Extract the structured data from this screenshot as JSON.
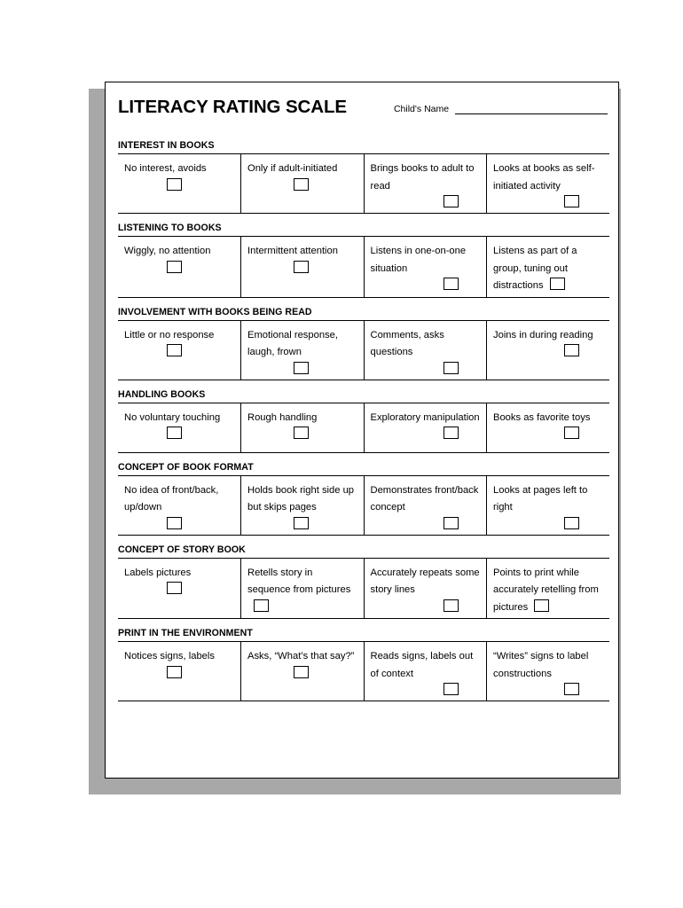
{
  "document": {
    "title": "LITERACY RATING SCALE",
    "name_field": {
      "label": "Child's Name",
      "value": ""
    }
  },
  "sections": [
    {
      "title": "INTEREST IN BOOKS",
      "items": [
        {
          "text": "No interest, avoids",
          "checkbox": "unchecked",
          "box_layout": "own-line",
          "box_pos": "pos-a"
        },
        {
          "text": "Only if adult-initiated",
          "checkbox": "unchecked",
          "box_layout": "own-line",
          "box_pos": "pos-b"
        },
        {
          "text": "Brings books to adult to read",
          "checkbox": "unchecked",
          "box_layout": "own-line",
          "box_pos": "pos-c"
        },
        {
          "text": "Looks at books as self-initiated activity",
          "checkbox": "unchecked",
          "box_layout": "own-line",
          "box_pos": "pos-d"
        }
      ]
    },
    {
      "title": "LISTENING TO BOOKS",
      "items": [
        {
          "text": "Wiggly, no attention",
          "checkbox": "unchecked",
          "box_layout": "own-line",
          "box_pos": "pos-a"
        },
        {
          "text": "Intermittent attention",
          "checkbox": "unchecked",
          "box_layout": "own-line",
          "box_pos": "pos-b"
        },
        {
          "text": "Listens in one-on-one situation",
          "checkbox": "unchecked",
          "box_layout": "own-line",
          "box_pos": "pos-c"
        },
        {
          "text": "Listens as part of a group, tuning out distractions",
          "checkbox": "unchecked",
          "box_layout": "inline"
        }
      ]
    },
    {
      "title": "INVOLVEMENT WITH BOOKS BEING READ",
      "items": [
        {
          "text": "Little or no response",
          "checkbox": "unchecked",
          "box_layout": "own-line",
          "box_pos": "pos-a"
        },
        {
          "text": "Emotional response, laugh, frown",
          "checkbox": "unchecked",
          "box_layout": "own-line",
          "box_pos": "pos-b"
        },
        {
          "text": "Comments, asks questions",
          "checkbox": "unchecked",
          "box_layout": "own-line",
          "box_pos": "pos-c"
        },
        {
          "text": "Joins in during reading",
          "checkbox": "unchecked",
          "box_layout": "own-line",
          "box_pos": "pos-d"
        }
      ]
    },
    {
      "title": "HANDLING BOOKS",
      "items": [
        {
          "text": "No voluntary touching",
          "checkbox": "unchecked",
          "box_layout": "own-line",
          "box_pos": "pos-a"
        },
        {
          "text": "Rough handling",
          "checkbox": "unchecked",
          "box_layout": "own-line",
          "box_pos": "pos-b"
        },
        {
          "text": "Exploratory manipulation",
          "checkbox": "unchecked",
          "box_layout": "own-line",
          "box_pos": "pos-c"
        },
        {
          "text": "Books as favorite toys",
          "checkbox": "unchecked",
          "box_layout": "own-line",
          "box_pos": "pos-d"
        }
      ]
    },
    {
      "title": "CONCEPT OF BOOK FORMAT",
      "items": [
        {
          "text": "No idea of front/back, up/down",
          "checkbox": "unchecked",
          "box_layout": "own-line",
          "box_pos": "pos-a"
        },
        {
          "text": "Holds book right side up but skips pages",
          "checkbox": "unchecked",
          "box_layout": "own-line",
          "box_pos": "pos-b"
        },
        {
          "text": "Demonstrates front/back concept",
          "checkbox": "unchecked",
          "box_layout": "own-line",
          "box_pos": "pos-c"
        },
        {
          "text": "Looks at pages left to right",
          "checkbox": "unchecked",
          "box_layout": "own-line",
          "box_pos": "pos-d"
        }
      ]
    },
    {
      "title": "CONCEPT OF STORY BOOK",
      "items": [
        {
          "text": "Labels pictures",
          "checkbox": "unchecked",
          "box_layout": "own-line",
          "box_pos": "pos-a"
        },
        {
          "text": "Retells story in sequence from pictures",
          "checkbox": "unchecked",
          "box_layout": "inline"
        },
        {
          "text": "Accurately repeats some story lines",
          "checkbox": "unchecked",
          "box_layout": "own-line",
          "box_pos": "pos-c"
        },
        {
          "text": "Points to print while accurately retelling from pictures",
          "checkbox": "unchecked",
          "box_layout": "inline"
        }
      ]
    },
    {
      "title": "PRINT IN THE ENVIRONMENT",
      "items": [
        {
          "text": "Notices signs, labels",
          "checkbox": "unchecked",
          "box_layout": "own-line",
          "box_pos": "pos-a"
        },
        {
          "text": "Asks, “What’s that say?”",
          "checkbox": "unchecked",
          "box_layout": "own-line",
          "box_pos": "pos-b"
        },
        {
          "text": "Reads signs, labels out of context",
          "checkbox": "unchecked",
          "box_layout": "own-line",
          "box_pos": "pos-c"
        },
        {
          "text": "“Writes” signs to label constructions",
          "checkbox": "unchecked",
          "box_layout": "own-line",
          "box_pos": "pos-d"
        }
      ]
    }
  ]
}
